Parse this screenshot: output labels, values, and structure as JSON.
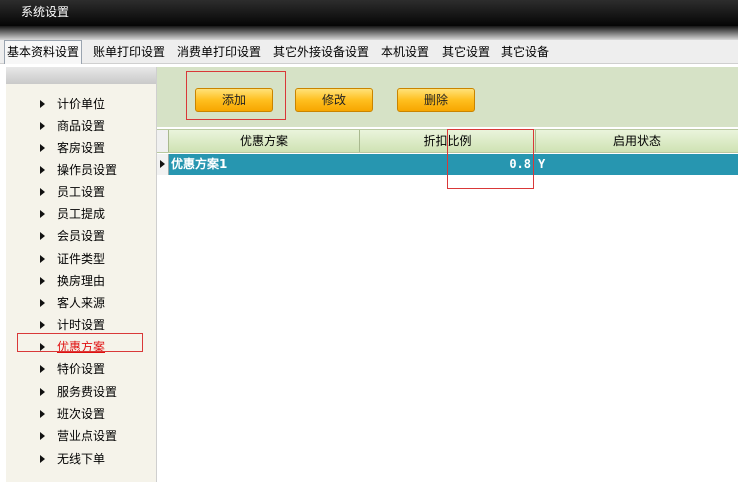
{
  "window": {
    "title": "系统设置"
  },
  "tabs": [
    {
      "label": "基本资料设置",
      "active": true
    },
    {
      "label": "账单打印设置"
    },
    {
      "label": "消费单打印设置"
    },
    {
      "label": "其它外接设备设置"
    },
    {
      "label": "本机设置"
    },
    {
      "label": "其它设置"
    },
    {
      "label": "其它设备"
    }
  ],
  "sidebar": {
    "selected": "优惠方案",
    "items": [
      {
        "label": "计价单位"
      },
      {
        "label": "商品设置"
      },
      {
        "label": "客房设置"
      },
      {
        "label": "操作员设置"
      },
      {
        "label": "员工设置"
      },
      {
        "label": "员工提成"
      },
      {
        "label": "会员设置"
      },
      {
        "label": "证件类型"
      },
      {
        "label": "换房理由"
      },
      {
        "label": "客人来源"
      },
      {
        "label": "计时设置"
      },
      {
        "label": "优惠方案"
      },
      {
        "label": "特价设置"
      },
      {
        "label": "服务费设置"
      },
      {
        "label": "班次设置"
      },
      {
        "label": "营业点设置"
      },
      {
        "label": "无线下单"
      }
    ]
  },
  "toolbar": {
    "add_label": "添加",
    "edit_label": "修改",
    "delete_label": "删除"
  },
  "grid": {
    "columns": [
      "优惠方案",
      "折扣比例",
      "启用状态"
    ],
    "rows": [
      {
        "name": "优惠方案1",
        "discount": "0.8",
        "enabled": "Y"
      }
    ]
  },
  "colors": {
    "selected_row": "#2796b0",
    "button": "#ffbf1f",
    "toolbar_bg": "#d6e2c6",
    "highlight": "#d93838",
    "selected_text": "#e01010"
  }
}
